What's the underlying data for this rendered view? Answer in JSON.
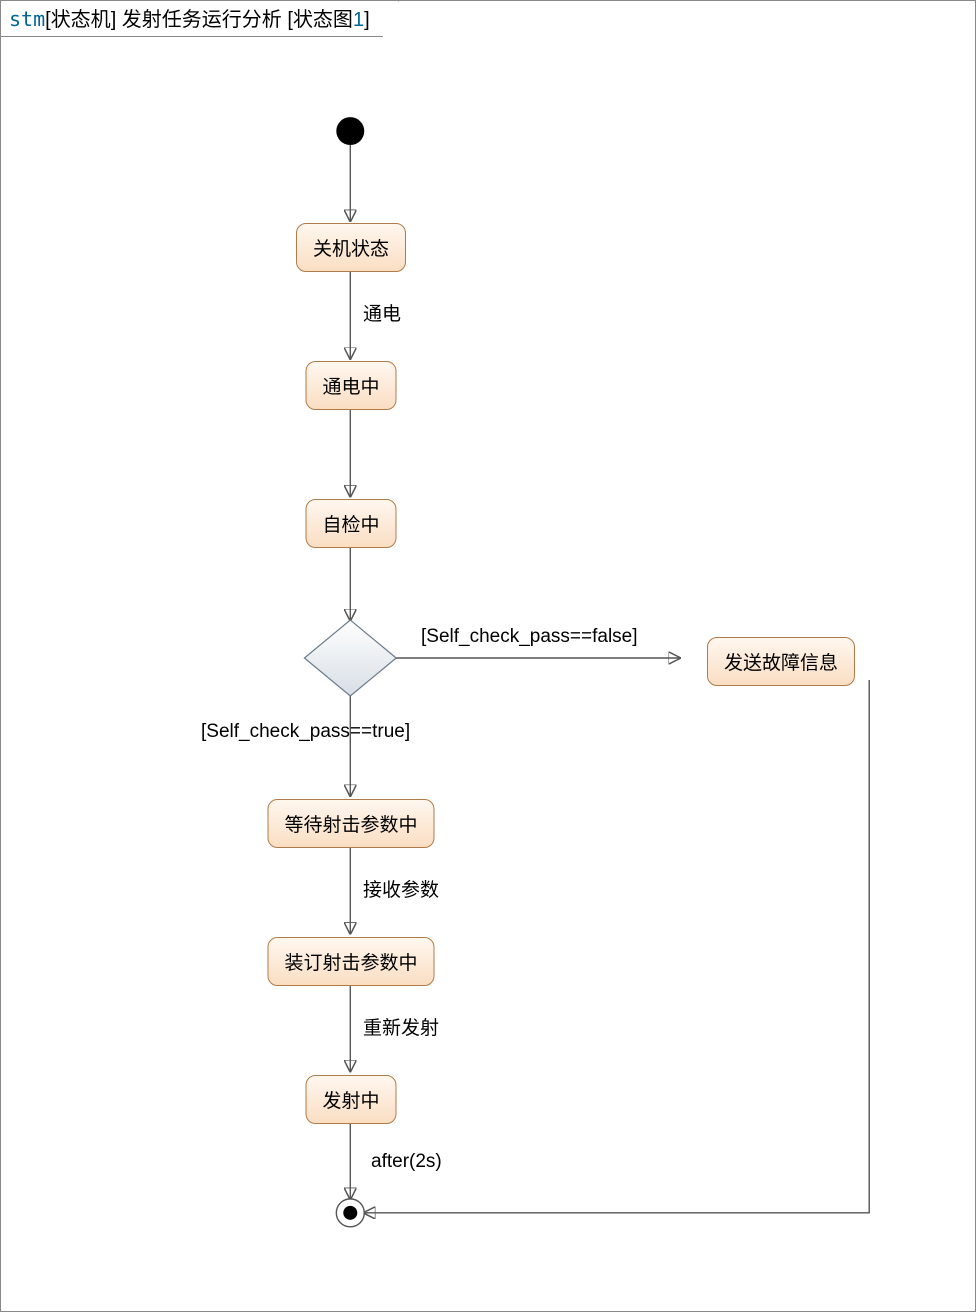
{
  "header": {
    "kw": "stm",
    "bracket1": "[",
    "type": "状态机",
    "bracket2": "]",
    "title": " 发射任务运行分析 ",
    "bracket3": "[",
    "name": "状态图",
    "num": "1",
    "bracket4": "]"
  },
  "states": {
    "s1": "关机状态",
    "s2": "通电中",
    "s3": "自检中",
    "s4": "等待射击参数中",
    "s5": "装订射击参数中",
    "s6": "发射中",
    "s7": "发送故障信息"
  },
  "labels": {
    "t1": "通电",
    "t2": "接收参数",
    "t3": "重新发射",
    "t4": "after(2s)",
    "g_true": "[Self_check_pass==true]",
    "g_false": "[Self_check_pass==false]"
  }
}
